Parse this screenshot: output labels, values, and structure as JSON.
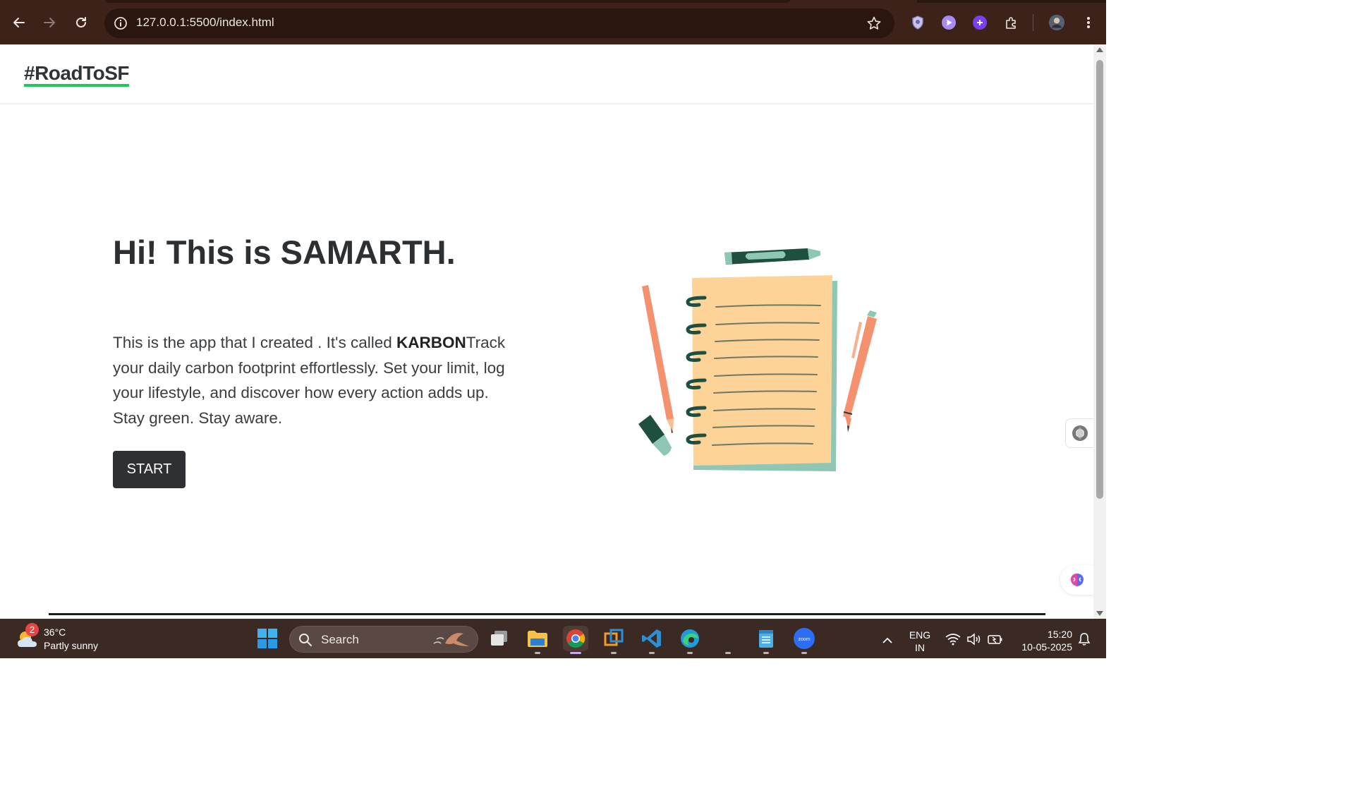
{
  "browser": {
    "url": "127.0.0.1:5500/index.html",
    "nav": {
      "back_icon": "arrow-left-icon",
      "forward_icon": "arrow-right-icon",
      "reload_icon": "reload-icon"
    },
    "extensions": [
      "shield-extension-icon",
      "play-extension-icon",
      "purple-extension-icon",
      "puzzle-icon",
      "profile-avatar",
      "kebab-menu-icon"
    ],
    "theme_color": "#3c2219"
  },
  "site": {
    "brand": "#RoadToSF",
    "brand_underline_color": "#22c55e",
    "hero": {
      "title": "Hi! This is SAMARTH.",
      "description_pre": "This is the app that I created . It's called ",
      "description_bold": "KARBON",
      "description_post": "Track your daily carbon footprint effortlessly. Set your limit, log your lifestyle, and discover how every action adds up. Stay green. Stay aware.",
      "start_label": "START"
    },
    "illustration": "notebook-with-stationery-illustration"
  },
  "taskbar": {
    "weather": {
      "badge": "2",
      "temperature": "36°C",
      "condition": "Partly sunny"
    },
    "search_placeholder": "Search",
    "apps": [
      "windows-start",
      "task-view",
      "file-explorer",
      "chrome",
      "vmware",
      "vscode",
      "edge",
      "app-blank",
      "notepad",
      "zoom"
    ],
    "tray": {
      "language_top": "ENG",
      "language_bottom": "IN",
      "time": "15:20",
      "date": "10-05-2025"
    }
  }
}
